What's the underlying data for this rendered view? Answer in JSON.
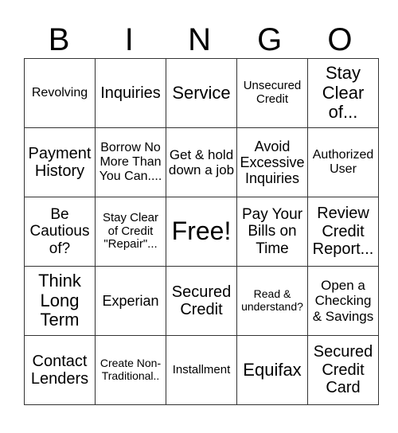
{
  "header": [
    "B",
    "I",
    "N",
    "G",
    "O"
  ],
  "rows": [
    [
      "Revolving",
      "Inquiries",
      "Service",
      "Unsecured Credit",
      "Stay Clear of..."
    ],
    [
      "Payment History",
      "Borrow No More Than You Can....",
      "Get & hold down a job",
      "Avoid Excessive Inquiries",
      "Authorized User"
    ],
    [
      "Be Cautious of?",
      "Stay Clear of Credit \"Repair\"...",
      "Free!",
      "Pay Your Bills on Time",
      "Review Credit Report..."
    ],
    [
      "Think Long Term",
      "Experian",
      "Secured Credit",
      "Read & understand?",
      "Open a Checking & Savings"
    ],
    [
      "Contact Lenders",
      "Create Non-Traditional..",
      "Installment",
      "Equifax",
      "Secured Credit Card"
    ]
  ]
}
